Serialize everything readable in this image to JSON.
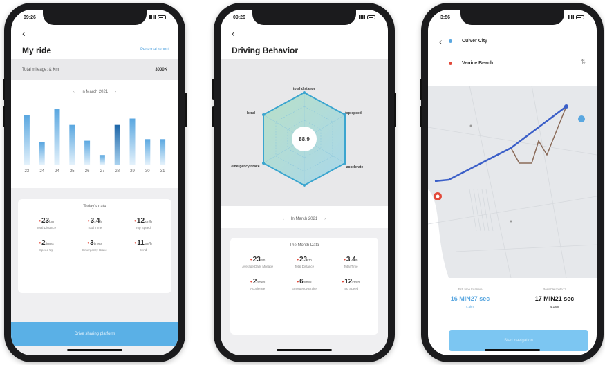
{
  "phone1": {
    "status_time": "09:26",
    "title": "My ride",
    "link": "Personal report",
    "mileage_label": "Total mileage: & Km",
    "mileage_value": "3000K",
    "month": "In March 2021",
    "chart_data": {
      "type": "bar",
      "categories": [
        "23",
        "24",
        "24",
        "25",
        "26",
        "27",
        "28",
        "29",
        "30",
        "31"
      ],
      "values": [
        62,
        28,
        70,
        50,
        30,
        12,
        50,
        58,
        32,
        32
      ],
      "highlight_index": 6,
      "ylim": [
        0,
        75
      ]
    },
    "card_title": "Today's data",
    "stats": [
      {
        "num": "23",
        "unit": "km",
        "label": "Total Distance"
      },
      {
        "num": "3.4",
        "unit": "h",
        "label": "Total Time"
      },
      {
        "num": "12",
        "unit": "km/h",
        "label": "Top Speed"
      },
      {
        "num": "2",
        "unit": "times",
        "label": "Speed Up"
      },
      {
        "num": "3",
        "unit": "times",
        "label": "Emergency Brake"
      },
      {
        "num": "11",
        "unit": "km/h",
        "label": "Bend"
      }
    ],
    "button": "Drive sharing platform"
  },
  "phone2": {
    "status_time": "09:26",
    "title": "Driving Behavior",
    "score": "88.9",
    "radar_labels": [
      "total distance",
      "top speed",
      "accelerate",
      "emergency brake",
      "bend"
    ],
    "month": "In March 2021",
    "card_title": "The Month Data",
    "stats": [
      {
        "num": "23",
        "unit": "km",
        "label": "Average Daily Mileage"
      },
      {
        "num": "23",
        "unit": "km",
        "label": "Total Distance"
      },
      {
        "num": "3.4",
        "unit": "h",
        "label": "Total Time"
      },
      {
        "num": "2",
        "unit": "times",
        "label": "Accelerate"
      },
      {
        "num": "6",
        "unit": "times",
        "label": "Emergency Brake"
      },
      {
        "num": "12",
        "unit": "km/h",
        "label": "Top Speed"
      }
    ]
  },
  "phone3": {
    "status_time": "3:56",
    "origin": "Culver City",
    "destination": "Venice Beach",
    "left_caption": "Est. time to arrive",
    "left_value": "16 MIN27 sec",
    "left_sub": "4.4km",
    "right_caption": "Possible route: 2",
    "right_value": "17 MIN21 sec",
    "right_sub": "4.1km",
    "button": "Start navigation",
    "colors": {
      "route_primary": "#3b5fc8",
      "route_alt": "#8a6a58",
      "start_pin": "#e24a3b"
    }
  }
}
